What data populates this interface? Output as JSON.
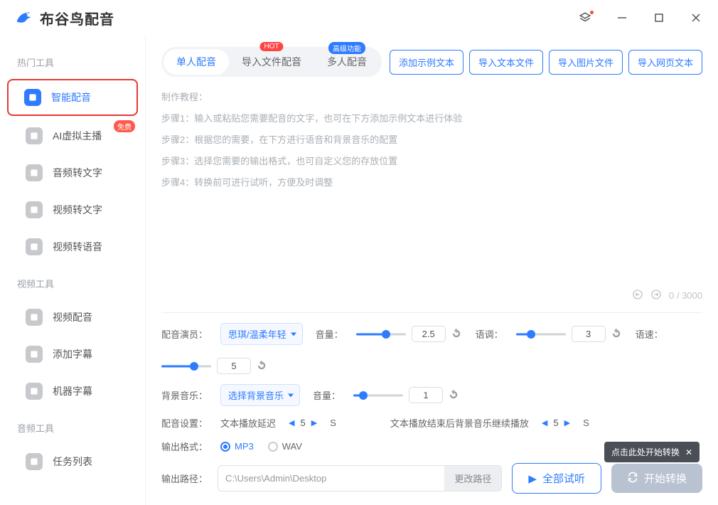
{
  "app": {
    "title": "布谷鸟配音"
  },
  "titlebar": {
    "layers_badge": true
  },
  "sidebar": {
    "sections": [
      {
        "title": "热门工具",
        "items": [
          {
            "label": "智能配音",
            "active": true
          },
          {
            "label": "AI虚拟主播",
            "badge": "免费"
          },
          {
            "label": "音频转文字"
          },
          {
            "label": "视频转文字"
          },
          {
            "label": "视频转语音"
          }
        ]
      },
      {
        "title": "视频工具",
        "items": [
          {
            "label": "视频配音"
          },
          {
            "label": "添加字幕"
          },
          {
            "label": "机器字幕"
          }
        ]
      },
      {
        "title": "音频工具",
        "items": [
          {
            "label": "任务列表"
          }
        ]
      }
    ]
  },
  "tabs": [
    {
      "label": "单人配音",
      "active": true
    },
    {
      "label": "导入文件配音",
      "badge": "HOT",
      "badge_type": "hot"
    },
    {
      "label": "多人配音",
      "badge": "高级功能",
      "badge_type": "adv"
    }
  ],
  "import_buttons": [
    "添加示例文本",
    "导入文本文件",
    "导入图片文件",
    "导入网页文本"
  ],
  "editor": {
    "placeholder_lines": [
      "制作教程：",
      "步骤1：输入或粘贴您需要配音的文字，也可在下方添加示例文本进行体验",
      "步骤2：根据您的需要，在下方进行语音和背景音乐的配置",
      "步骤3：选择您需要的输出格式，也可自定义您的存放位置",
      "步骤4：转换前可进行试听，方便及时调整"
    ],
    "counter": "0 / 3000"
  },
  "controls": {
    "voice_label": "配音演员：",
    "voice_value": "思琪/温柔年轻",
    "volume_label": "音量：",
    "volume_value": "2.5",
    "volume_pct": 60,
    "pitch_label": "语调：",
    "pitch_value": "3",
    "pitch_pct": 30,
    "speed_label": "语速：",
    "speed_value": "5",
    "speed_pct": 65,
    "bgm_label": "背景音乐：",
    "bgm_value": "选择背景音乐",
    "bgm_volume_label": "音量：",
    "bgm_volume_value": "1",
    "bgm_volume_pct": 20,
    "settings_label": "配音设置：",
    "delay_label": "文本播放延迟",
    "delay_value": "5",
    "delay_unit": "S",
    "continue_label": "文本播放结束后背景音乐继续播放",
    "continue_value": "5",
    "continue_unit": "S",
    "format_label": "输出格式：",
    "format_options": [
      "MP3",
      "WAV"
    ],
    "format_selected": "MP3",
    "path_label": "输出路径：",
    "path_value": "C:\\Users\\Admin\\Desktop",
    "path_change": "更改路径"
  },
  "actions": {
    "preview": "全部试听",
    "convert": "开始转换"
  },
  "tooltip": {
    "text": "点击此处开始转换"
  }
}
